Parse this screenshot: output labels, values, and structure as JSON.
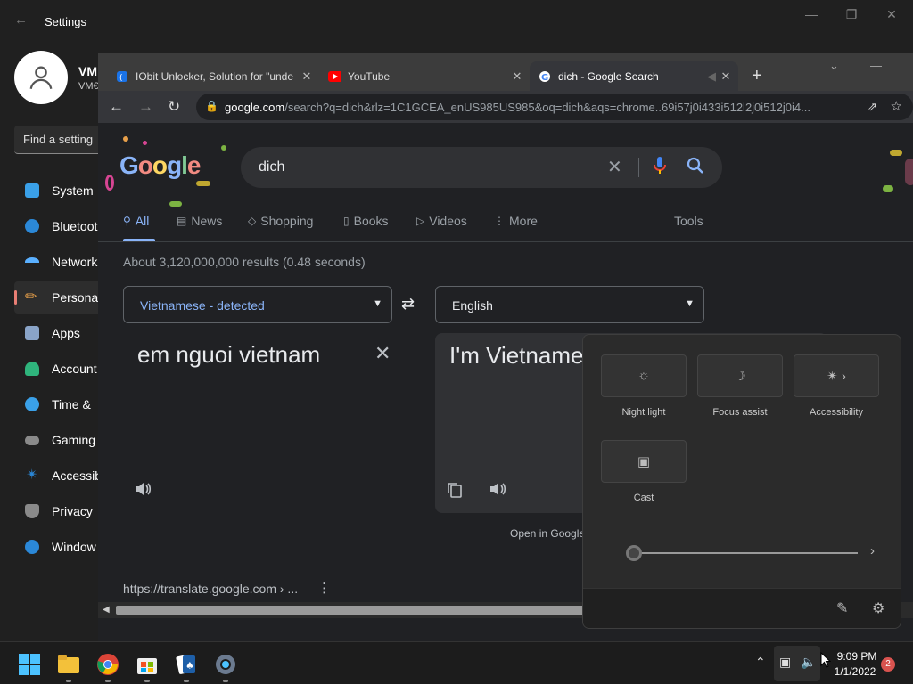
{
  "settings": {
    "title": "Settings",
    "user_name": "VM",
    "user_sub": "VM€",
    "search_placeholder": "Find a setting",
    "nav": [
      {
        "label": "System",
        "color": "#3aa0e8"
      },
      {
        "label": "Bluetoot",
        "color": "#2b88d8"
      },
      {
        "label": "Network",
        "color": "#5ab0ff"
      },
      {
        "label": "Persona",
        "color": "#e8a04a"
      },
      {
        "label": "Apps",
        "color": "#8aa4c8"
      },
      {
        "label": "Account",
        "color": "#2fb47c"
      },
      {
        "label": "Time &",
        "color": "#3aa0e8"
      },
      {
        "label": "Gaming",
        "color": "#8a8a8a"
      },
      {
        "label": "Accessib",
        "color": "#2b88d8"
      },
      {
        "label": "Privacy",
        "color": "#8a8a8a"
      },
      {
        "label": "Window",
        "color": "#2b88d8"
      }
    ]
  },
  "chrome": {
    "tabs": [
      {
        "title": "IObit Unlocker, Solution for \"unde",
        "icon": "iobit-icon"
      },
      {
        "title": "YouTube",
        "icon": "youtube-icon"
      },
      {
        "title": "dich - Google Search",
        "icon": "google-icon"
      }
    ],
    "url_host": "google.com",
    "url_path": "/search?q=dich&rlz=1C1GCEA_enUS985US985&oq=dich&aqs=chrome..69i57j0i433i512l2j0i512j0i4..."
  },
  "google": {
    "logo": "Google",
    "query": "dich",
    "tabs": [
      "All",
      "News",
      "Shopping",
      "Books",
      "Videos",
      "More"
    ],
    "tools": "Tools",
    "stats": "About 3,120,000,000 results (0.48 seconds)",
    "source_lang": "Vietnamese - detected",
    "target_lang": "English",
    "source_text": "em nguoi vietnam",
    "target_text": "I'm Vietname",
    "open_in": "Open in Google Translate",
    "result_url": "https://translate.google.com › ..."
  },
  "quick_settings": {
    "buttons": [
      {
        "label": "Night light",
        "icon": "brightness-icon"
      },
      {
        "label": "Focus assist",
        "icon": "moon-icon"
      },
      {
        "label": "Accessibility",
        "icon": "accessibility-icon"
      },
      {
        "label": "Cast",
        "icon": "cast-icon"
      }
    ],
    "slider_value": 0
  },
  "taskbar": {
    "time": "9:09 PM",
    "date": "1/1/2022",
    "notifications": "2"
  }
}
